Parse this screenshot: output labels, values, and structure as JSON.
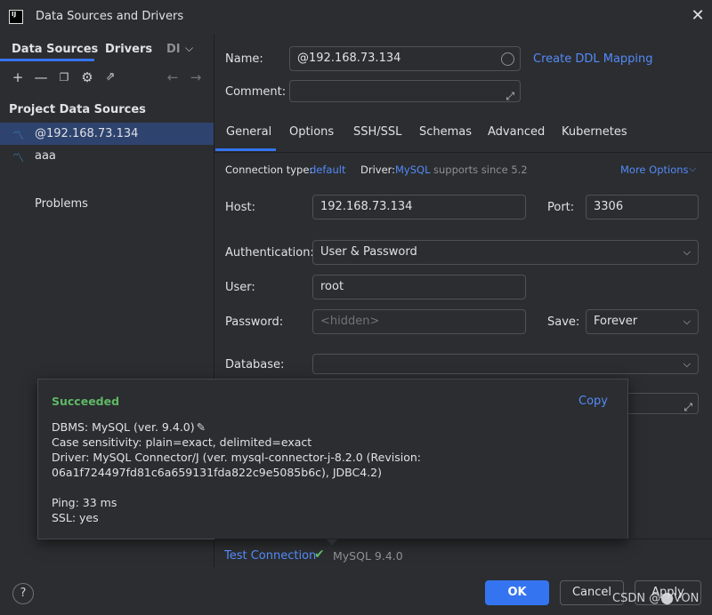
{
  "window": {
    "title": "Data Sources and Drivers",
    "logo": "IJ"
  },
  "left": {
    "tabs": [
      "Data Sources",
      "Drivers",
      "DI"
    ],
    "tabs_more_icon": "chevron-down-icon",
    "section_title": "Project Data Sources",
    "items": [
      {
        "label": "@192.168.73.134",
        "selected": true
      },
      {
        "label": "aaa",
        "selected": false
      }
    ],
    "problems": "Problems"
  },
  "form": {
    "name_label": "Name:",
    "name_value": "@192.168.73.134",
    "create_ddl": "Create DDL Mapping",
    "comment_label": "Comment:",
    "comment_value": "",
    "tabs": [
      "General",
      "Options",
      "SSH/SSL",
      "Schemas",
      "Advanced",
      "Kubernetes"
    ],
    "conn_type_label": "Connection type:",
    "conn_type_value": "default",
    "driver_label": "Driver:",
    "driver_value": "MySQL",
    "driver_note": "supports since 5.2",
    "more_options": "More Options",
    "host_label": "Host:",
    "host_value": "192.168.73.134",
    "port_label": "Port:",
    "port_value": "3306",
    "auth_label": "Authentication:",
    "auth_value": "User & Password",
    "user_label": "User:",
    "user_value": "root",
    "password_label": "Password:",
    "password_placeholder": "<hidden>",
    "save_label": "Save:",
    "save_value": "Forever",
    "database_label": "Database:",
    "database_value": ""
  },
  "popup": {
    "status": "Succeeded",
    "copy": "Copy",
    "lines": [
      "DBMS: MySQL (ver. 9.4.0)",
      "Case sensitivity: plain=exact, delimited=exact",
      "Driver: MySQL Connector/J (ver. mysql-connector-j-8.2.0 (Revision:",
      "06a1f724497fd81c6a659131fda822c9e5085b6c), JDBC4.2)",
      "Ping: 33 ms",
      "SSL: yes"
    ]
  },
  "footer": {
    "test_connection": "Test Connection",
    "test_result": "MySQL 9.4.0",
    "help": "?",
    "ok": "OK",
    "cancel": "Cancel",
    "apply": "Apply",
    "watermark": "CSDN @⬤VON"
  },
  "colors": {
    "accent": "#3574f0",
    "link": "#548af7",
    "success": "#5fb865"
  }
}
